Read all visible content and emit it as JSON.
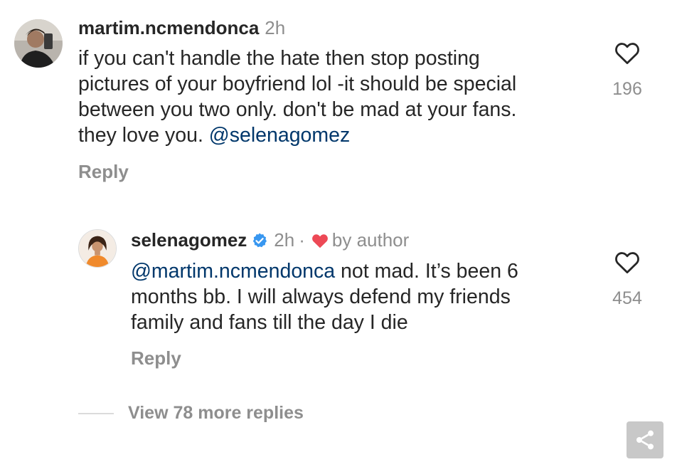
{
  "comment": {
    "username": "martim.ncmendonca",
    "time": "2h",
    "text_lines": [
      "if you can't handle the hate then stop posting",
      "pictures of your boyfriend lol -it should be special",
      "between you two only. don't be mad at your fans."
    ],
    "last_line_prefix": "they love you. ",
    "mention": "@selenagomez",
    "reply_label": "Reply",
    "like_count": "196",
    "avatar_icon": "person-avatar"
  },
  "reply": {
    "username": "selenagomez",
    "verified_icon": "verified-badge-icon",
    "time": "2h",
    "separator": "·",
    "by_author_icon": "heart-filled-icon",
    "by_author_label": "by author",
    "mention": "@martim.ncmendonca",
    "first_line_rest": " not mad. It’s been 6",
    "text_lines": [
      "months bb. I will always defend my friends",
      "family and fans till the day I die"
    ],
    "reply_label": "Reply",
    "like_count": "454",
    "avatar_icon": "person-avatar"
  },
  "view_more": {
    "label": "View 78 more replies"
  },
  "share_button": {
    "icon": "share-icon"
  },
  "colors": {
    "text": "#262626",
    "secondary": "#8e8e8e",
    "mention": "#00376b",
    "verified": "#3897f0",
    "heart": "#ed4956"
  }
}
